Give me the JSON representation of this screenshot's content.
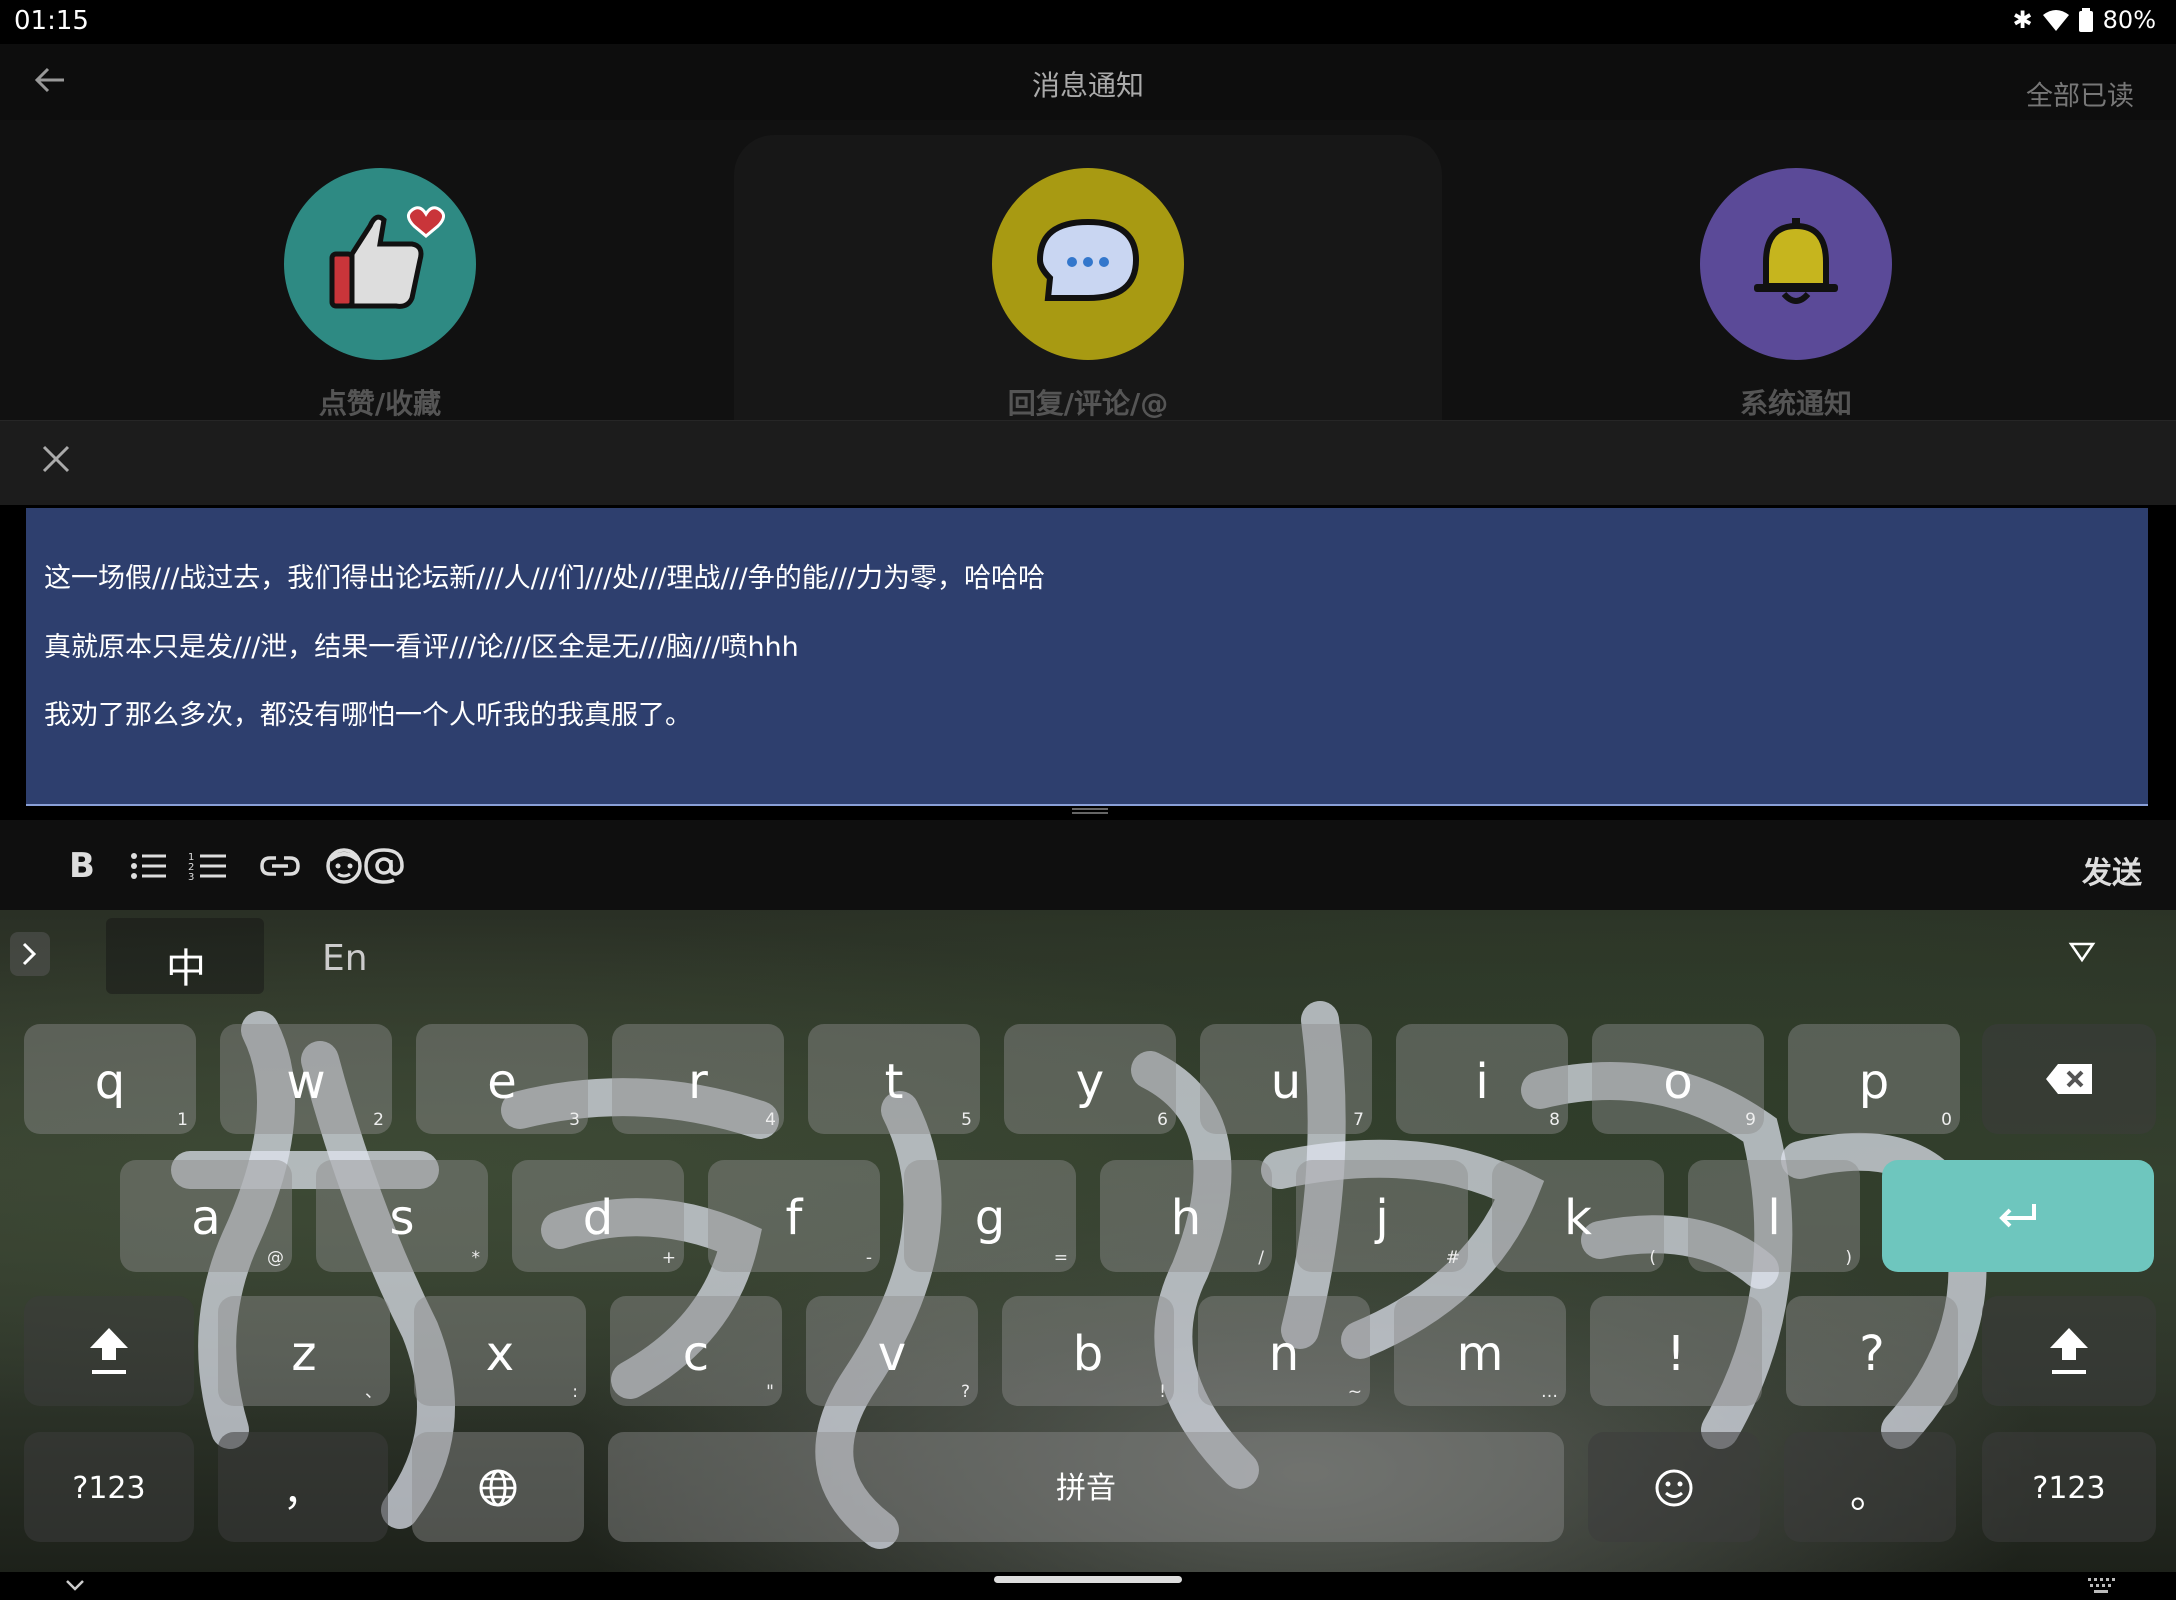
{
  "status_bar": {
    "time": "01:15",
    "battery": "80%"
  },
  "app_bar": {
    "title": "消息通知",
    "mark_all_read": "全部已读"
  },
  "categories": [
    {
      "label": "点赞/收藏",
      "color": "#2e8a83"
    },
    {
      "label": "回复/评论/@",
      "color": "#a89a12"
    },
    {
      "label": "系统通知",
      "color": "#5b4a98"
    }
  ],
  "editor": {
    "lines": [
      "这一场假///战过去，我们得出论坛新///人///们///处///理战///争的能///力为零，哈哈哈",
      "真就原本只是发///泄，结果一看评///论///区全是无///脑///喷hhh",
      "我劝了那么多次，都没有哪怕一个人听我的我真服了。"
    ]
  },
  "toolbar": {
    "bold": "B",
    "send": "发送"
  },
  "keyboard": {
    "lang_zh": "中",
    "lang_en": "En",
    "row1": [
      {
        "k": "q",
        "s": "1"
      },
      {
        "k": "w",
        "s": "2"
      },
      {
        "k": "e",
        "s": "3"
      },
      {
        "k": "r",
        "s": "4"
      },
      {
        "k": "t",
        "s": "5"
      },
      {
        "k": "y",
        "s": "6"
      },
      {
        "k": "u",
        "s": "7"
      },
      {
        "k": "i",
        "s": "8"
      },
      {
        "k": "o",
        "s": "9"
      },
      {
        "k": "p",
        "s": "0"
      }
    ],
    "row2": [
      {
        "k": "a",
        "s": "@"
      },
      {
        "k": "s",
        "s": "*"
      },
      {
        "k": "d",
        "s": "+"
      },
      {
        "k": "f",
        "s": "-"
      },
      {
        "k": "g",
        "s": "="
      },
      {
        "k": "h",
        "s": "/"
      },
      {
        "k": "j",
        "s": "#"
      },
      {
        "k": "k",
        "s": "("
      },
      {
        "k": "l",
        "s": ")"
      }
    ],
    "row3": [
      {
        "k": "z",
        "s": "、"
      },
      {
        "k": "x",
        "s": ":"
      },
      {
        "k": "c",
        "s": "\""
      },
      {
        "k": "v",
        "s": "?"
      },
      {
        "k": "b",
        "s": "!"
      },
      {
        "k": "n",
        "s": "~"
      },
      {
        "k": "m",
        "s": "…"
      },
      {
        "k": "!",
        "s": ""
      },
      {
        "k": "?",
        "s": ""
      }
    ],
    "symbols": "?123",
    "comma": "，",
    "space": "拼音",
    "period": "。",
    "symbols_right": "?123"
  }
}
